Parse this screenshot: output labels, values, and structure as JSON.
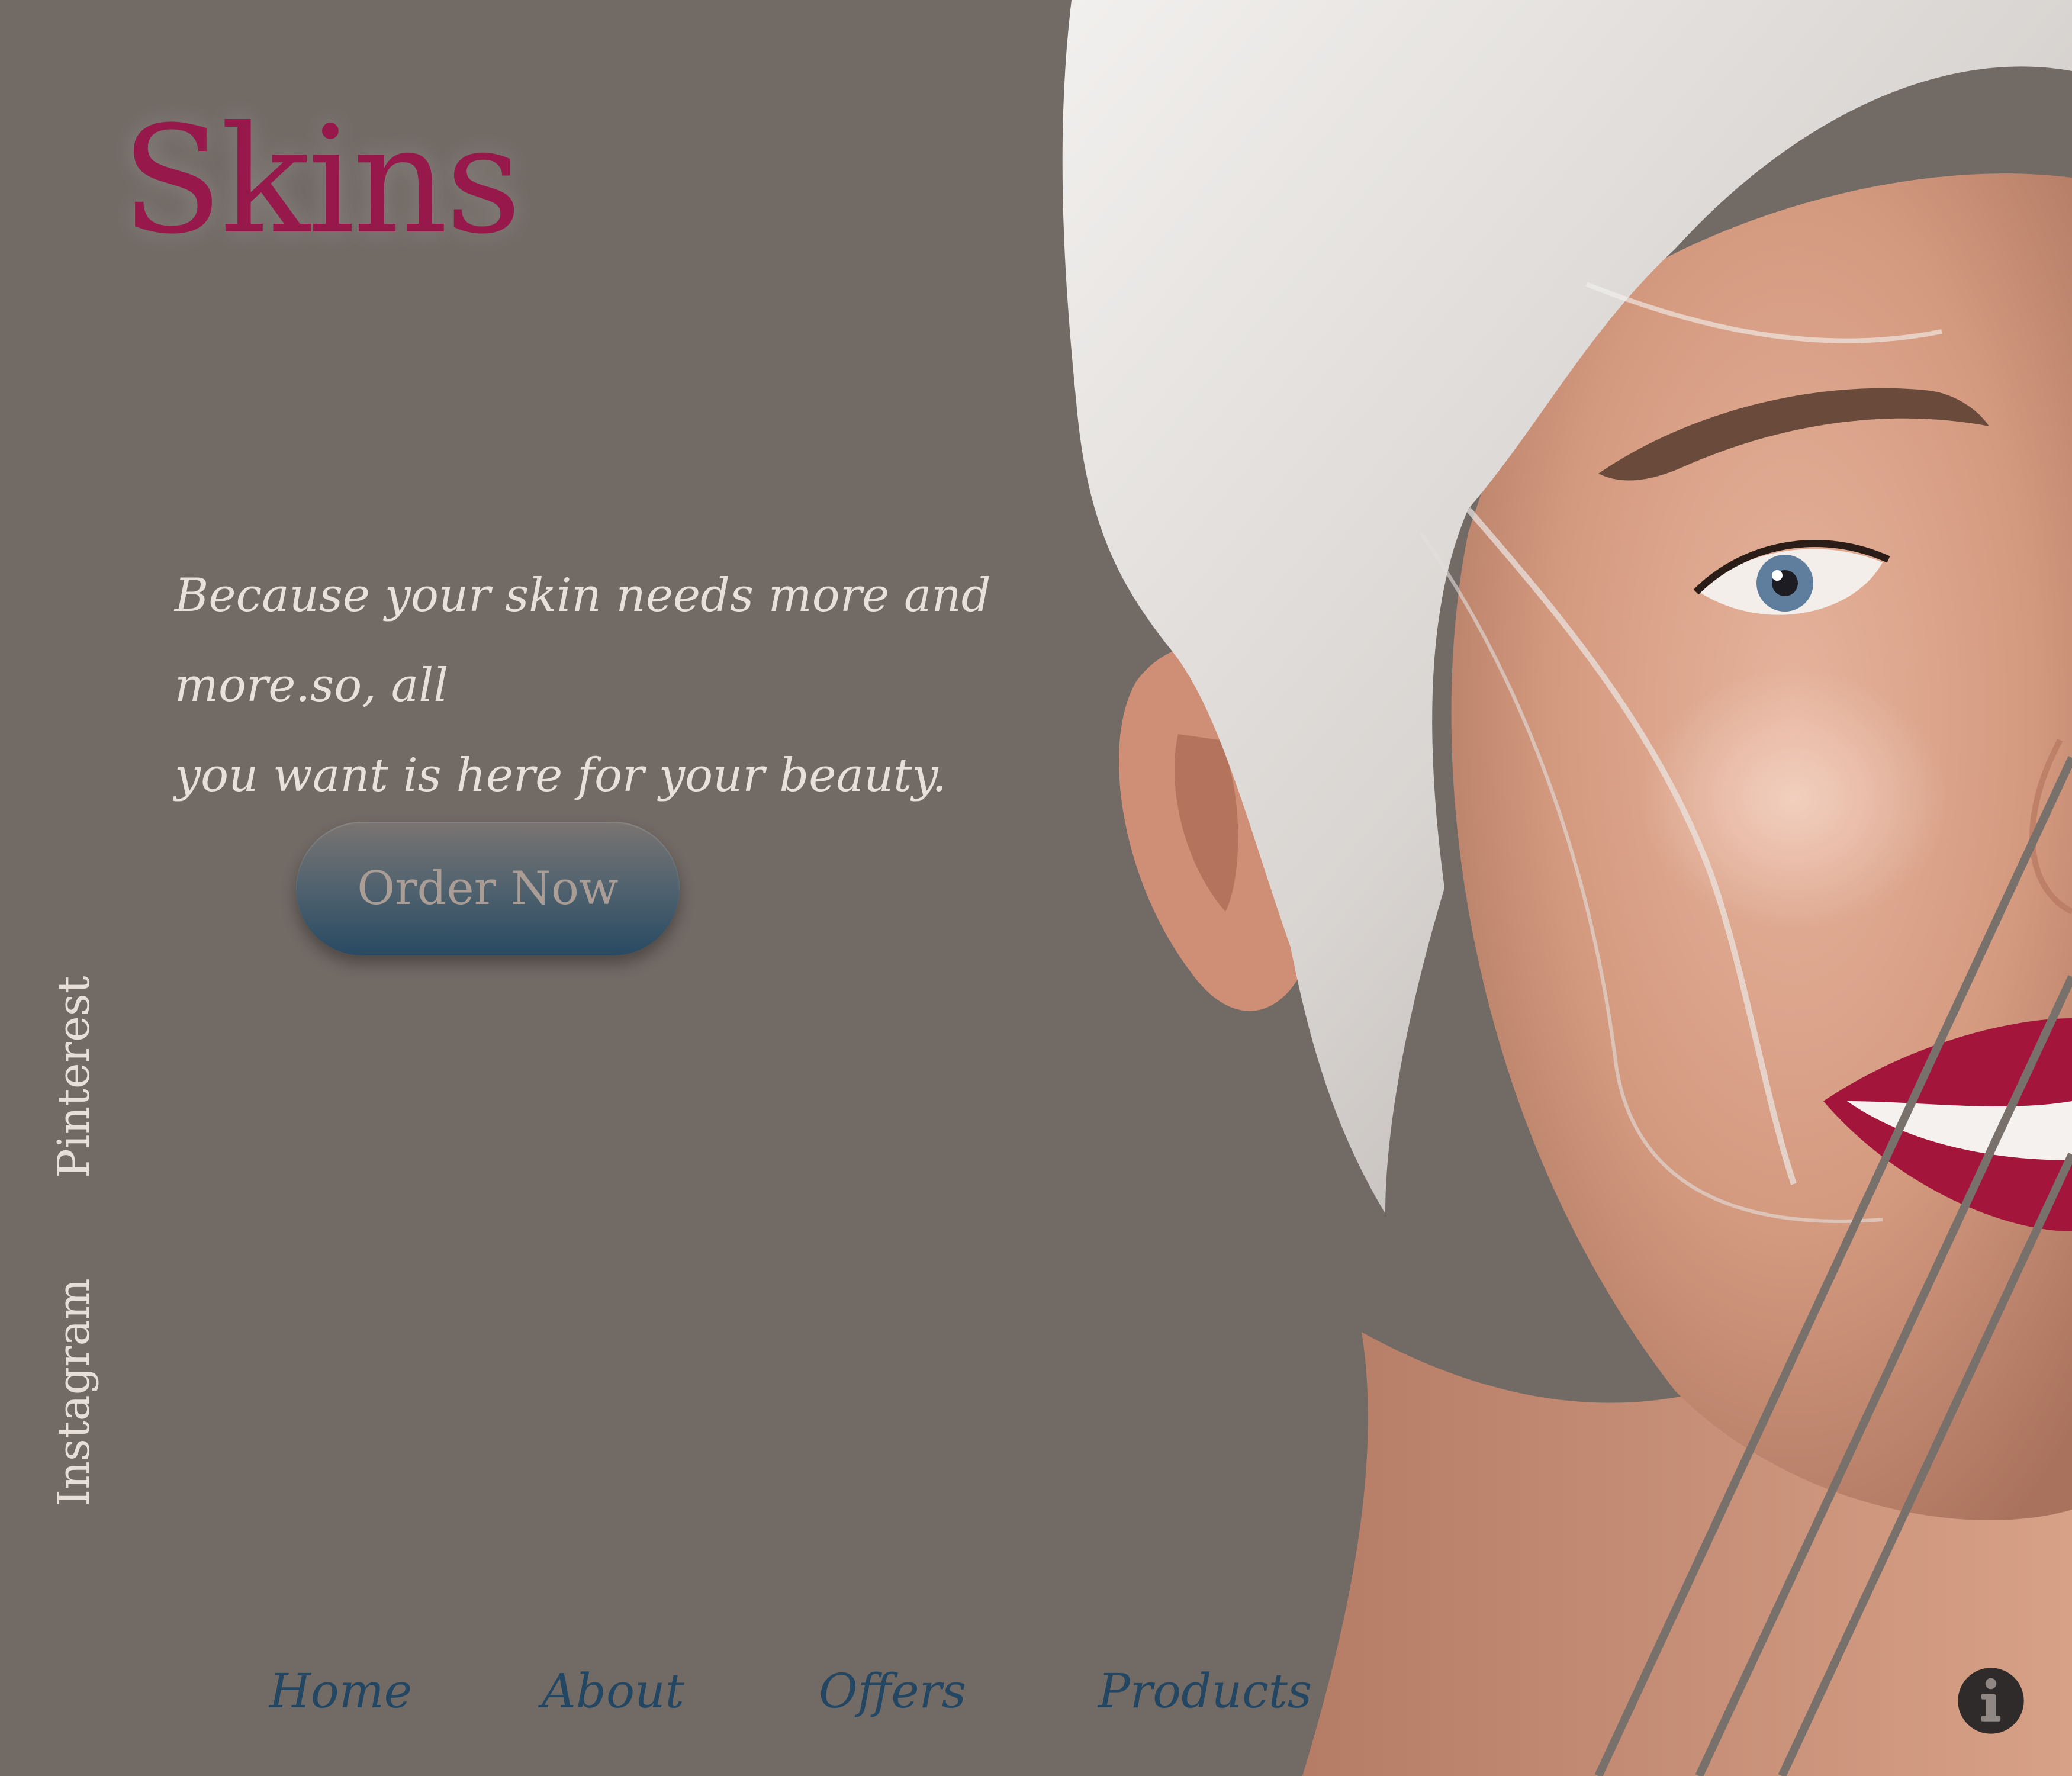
{
  "brand": {
    "name": "Skins"
  },
  "hero": {
    "tagline_line1": "Because your skin needs more and more.so, all",
    "tagline_line2": "you want is here for your beauty.",
    "cta_label": "Order Now"
  },
  "social": {
    "pinterest": "Pinterest",
    "instagram": "Instagram"
  },
  "nav": [
    {
      "label": "Home"
    },
    {
      "label": "About"
    },
    {
      "label": "Offers"
    },
    {
      "label": "Products"
    }
  ],
  "icons": {
    "info": "info-icon"
  },
  "colors": {
    "background": "#726a65",
    "brand": "#97184a",
    "nav_text": "#234763",
    "cta_gradient_bottom": "#284a62",
    "tagline": "#e9e0d9"
  }
}
